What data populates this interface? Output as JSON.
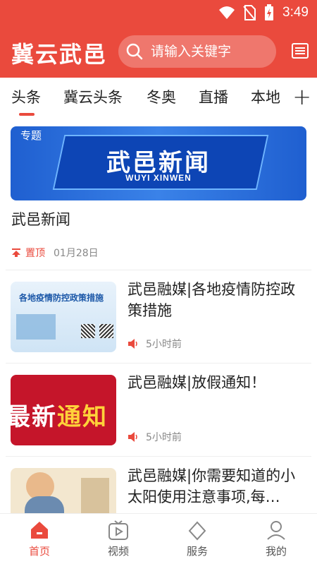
{
  "status_bar": {
    "time": "3:49"
  },
  "header": {
    "app_title": "冀云武邑",
    "search_placeholder": "请输入关键字"
  },
  "tabs": [
    "头条",
    "冀云头条",
    "冬奥",
    "直播",
    "本地"
  ],
  "feature": {
    "tag": "专题",
    "banner_title": "武邑新闻",
    "banner_subtitle": "WUYI XINWEN",
    "title": "武邑新闻",
    "pin_label": "置顶",
    "date": "01月28日"
  },
  "news": [
    {
      "title": "武邑融媒|各地疫情防控政策措施",
      "time": "5小时前",
      "thumb_text": "各地疫情防控政策措施"
    },
    {
      "title": "武邑融媒|放假通知！",
      "time": "5小时前",
      "thumb_text_white": "最新",
      "thumb_text_yellow": "通知"
    },
    {
      "title": "武邑融媒|你需要知道的小太阳使用注意事项,每…",
      "time": ""
    }
  ],
  "bottom_nav": [
    {
      "label": "首页",
      "active": true
    },
    {
      "label": "视频",
      "active": false
    },
    {
      "label": "服务",
      "active": false
    },
    {
      "label": "我的",
      "active": false
    }
  ],
  "colors": {
    "brand": "#ea4a3d",
    "banner_blue": "#1f5fd0"
  }
}
